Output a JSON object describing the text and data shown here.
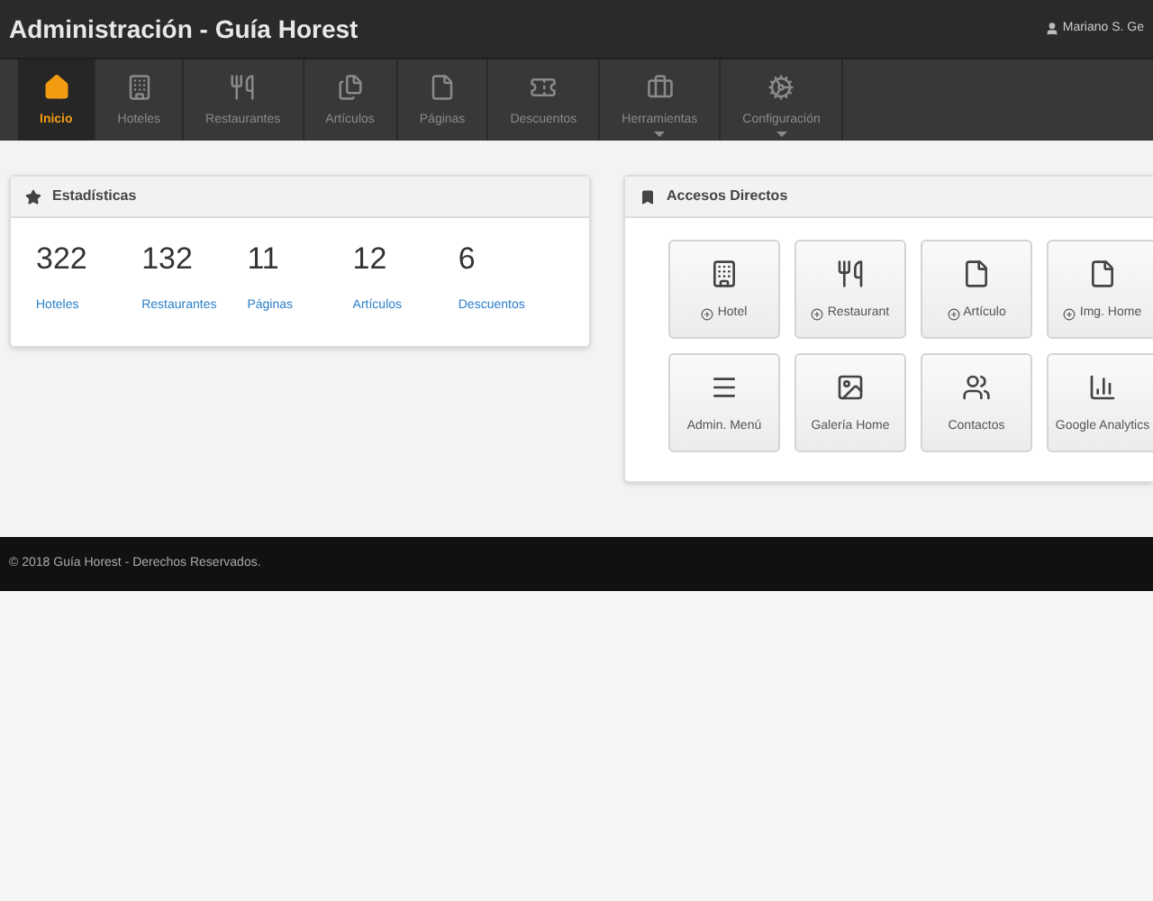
{
  "header": {
    "title": "Administración - Guía Horest",
    "user": "Mariano S. Ge"
  },
  "nav": [
    {
      "label": "Inicio",
      "selected": true,
      "submenu": false
    },
    {
      "label": "Hoteles",
      "selected": false,
      "submenu": false
    },
    {
      "label": "Restaurantes",
      "selected": false,
      "submenu": false
    },
    {
      "label": "Artículos",
      "selected": false,
      "submenu": false
    },
    {
      "label": "Páginas",
      "selected": false,
      "submenu": false
    },
    {
      "label": "Descuentos",
      "selected": false,
      "submenu": false
    },
    {
      "label": "Herramientas",
      "selected": false,
      "submenu": true
    },
    {
      "label": "Configuración",
      "selected": false,
      "submenu": true
    }
  ],
  "stats": {
    "title": "Estadísticas",
    "items": [
      {
        "value": "322",
        "label": "Hoteles"
      },
      {
        "value": "132",
        "label": "Restaurantes"
      },
      {
        "value": "11",
        "label": "Páginas"
      },
      {
        "value": "12",
        "label": "Artículos"
      },
      {
        "value": "6",
        "label": "Descuentos"
      }
    ]
  },
  "shortcuts": {
    "title": "Accesos Directos",
    "items": [
      {
        "label": "Hotel",
        "add": true
      },
      {
        "label": "Restaurant",
        "add": true
      },
      {
        "label": "Artículo",
        "add": true
      },
      {
        "label": "Img. Home",
        "add": true
      },
      {
        "label": "Admin. Menú",
        "add": false
      },
      {
        "label": "Galería Home",
        "add": false
      },
      {
        "label": "Contactos",
        "add": false
      },
      {
        "label": "Google Analytics",
        "add": false
      }
    ]
  },
  "footer": "© 2018 Guía Horest - Derechos Reservados."
}
